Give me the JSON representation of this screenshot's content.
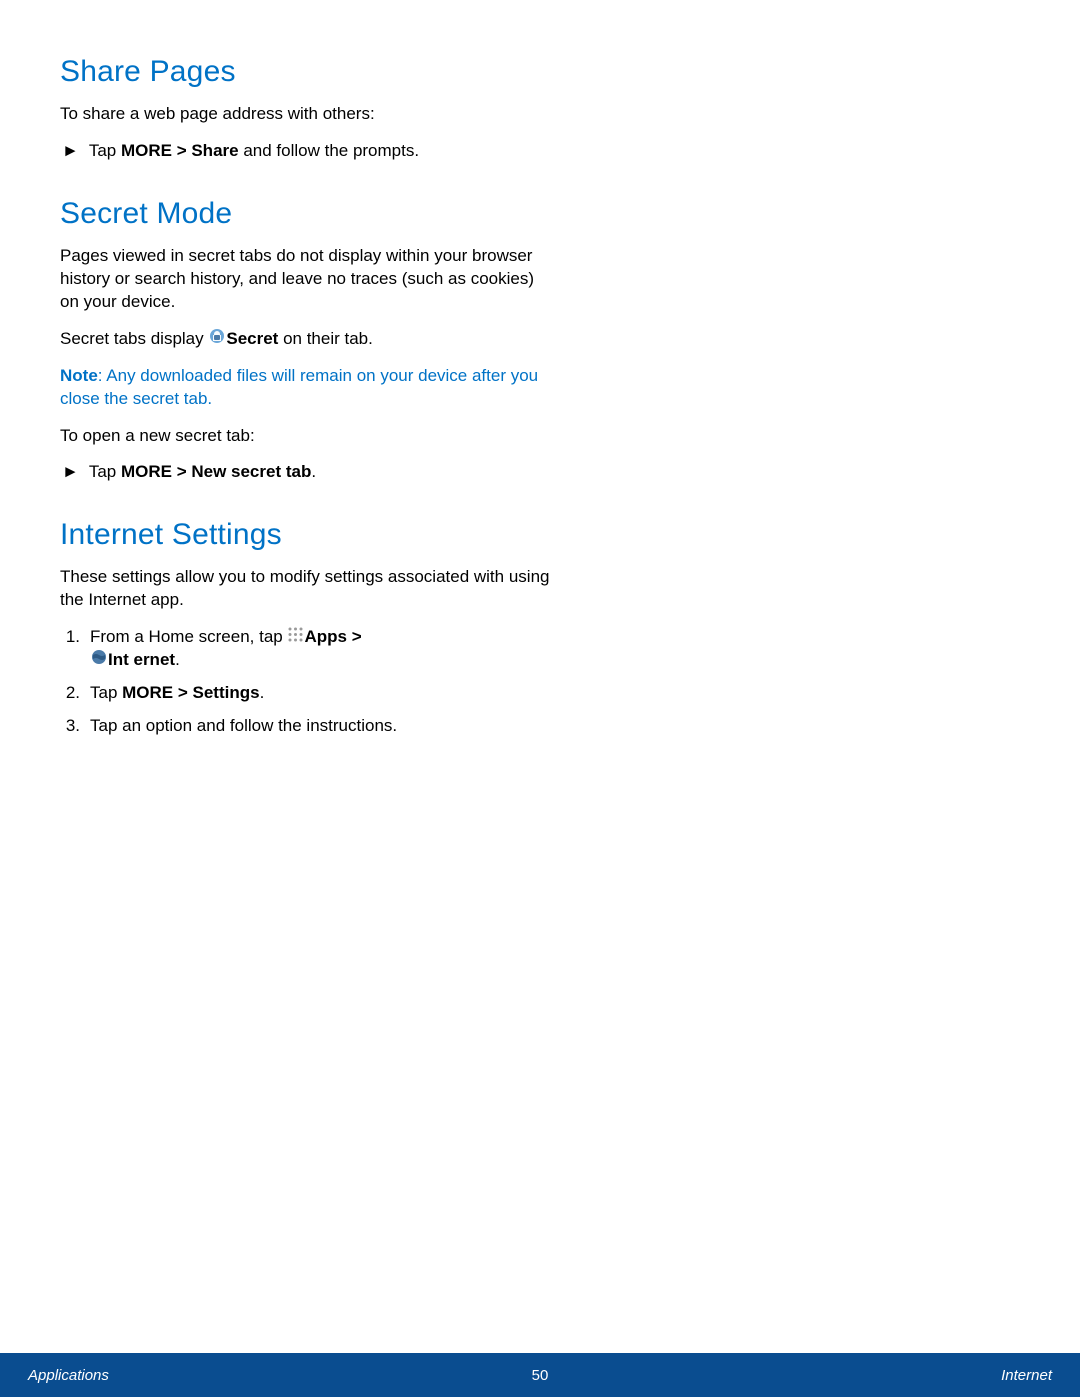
{
  "sections": {
    "share": {
      "heading": "Share Pages",
      "intro": "To share a web page address with others:",
      "bullet_prefix": "Tap ",
      "bullet_bold": "MORE > Share",
      "bullet_suffix": " and follow the prompts."
    },
    "secret": {
      "heading": "Secret Mode",
      "p1": "Pages viewed in secret tabs do not display within your browser history or search history, and leave no traces (such as cookies) on your device.",
      "p2_prefix": "Secret tabs display ",
      "p2_bold": "Secret",
      "p2_suffix": " on their tab.",
      "note_label": "Note",
      "note_text": ": Any downloaded files will remain on your device after you close the secret tab.",
      "p3": "To open a new secret tab:",
      "bullet_prefix": "Tap ",
      "bullet_bold": "MORE > New secret tab",
      "bullet_suffix": "."
    },
    "settings": {
      "heading": "Internet Settings",
      "intro": "These settings allow you to modify settings associated with using the Internet app.",
      "step1_num": "1.",
      "step1_prefix": "From a Home screen, tap ",
      "step1_apps": "Apps",
      "step1_gt": " > ",
      "step1_internet": "Int ernet",
      "step1_suffix": ".",
      "step2_num": "2.",
      "step2_prefix": "Tap ",
      "step2_bold": "MORE > Settings",
      "step2_suffix": ".",
      "step3_num": "3.",
      "step3_text": "Tap an option and follow the instructions."
    }
  },
  "footer": {
    "left": "Applications",
    "center": "50",
    "right": "Internet"
  }
}
